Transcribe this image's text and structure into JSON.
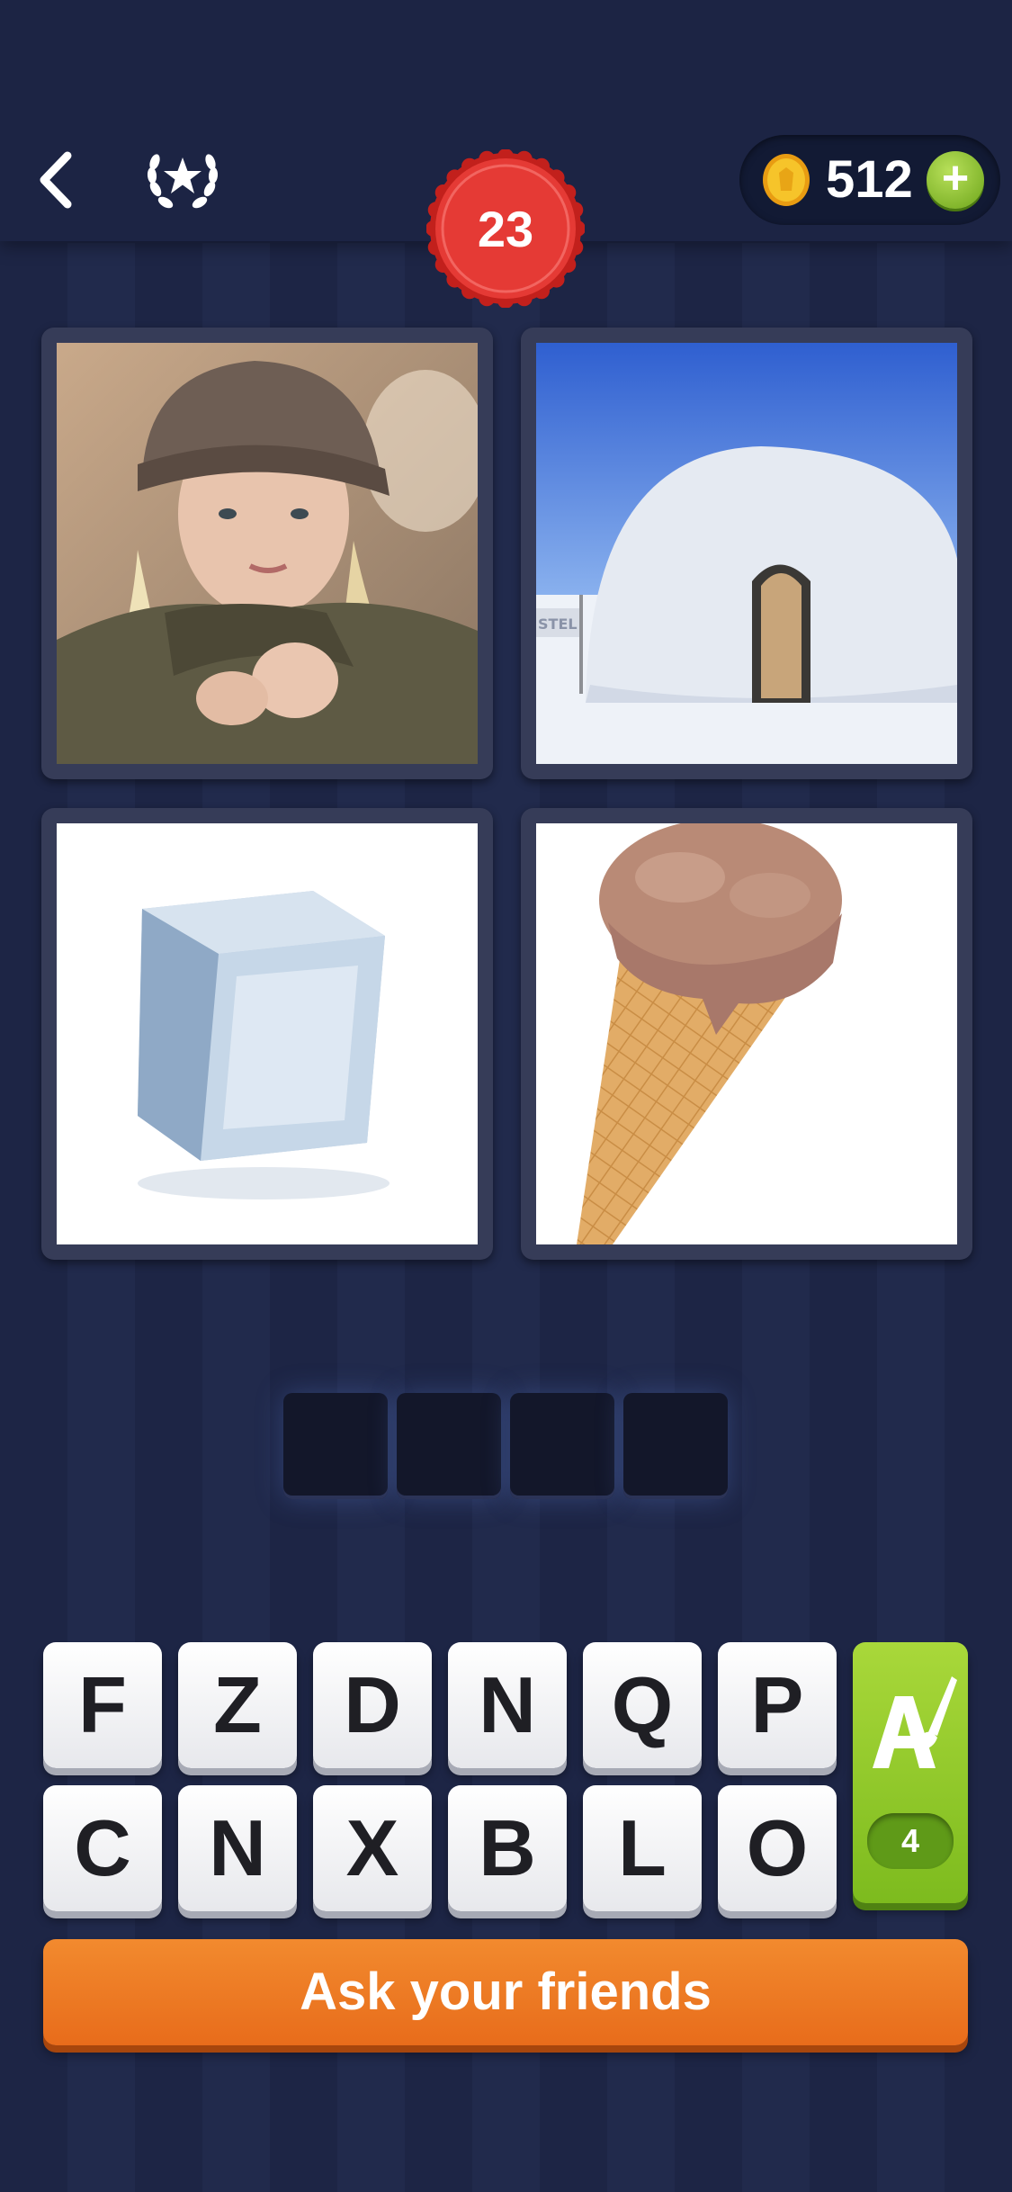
{
  "header": {
    "level": "23",
    "coins": "512",
    "coins_add": "+",
    "back_icon": "chevron-left-icon",
    "achievements_icon": "laurel-star-icon"
  },
  "puzzle": {
    "images": [
      {
        "subject": "woman-in-winter-hat"
      },
      {
        "subject": "igloo"
      },
      {
        "subject": "ice-cube"
      },
      {
        "subject": "ice-cream-cone"
      }
    ],
    "igloo_sign_fragment": "STEL",
    "answer_length": 4
  },
  "keyboard": {
    "row1": [
      "F",
      "Z",
      "D",
      "N",
      "Q",
      "P"
    ],
    "row2": [
      "C",
      "N",
      "X",
      "B",
      "L",
      "O"
    ]
  },
  "hint": {
    "cost": "4",
    "icon": "paintbrush-letter-icon"
  },
  "ask_button": {
    "label": "Ask your friends"
  },
  "colors": {
    "background": "#1d2545",
    "level_badge": "#e53a35",
    "hint_green": "#8cc62a",
    "ask_orange": "#ee7a24",
    "coin_gold": "#f2b81e"
  }
}
